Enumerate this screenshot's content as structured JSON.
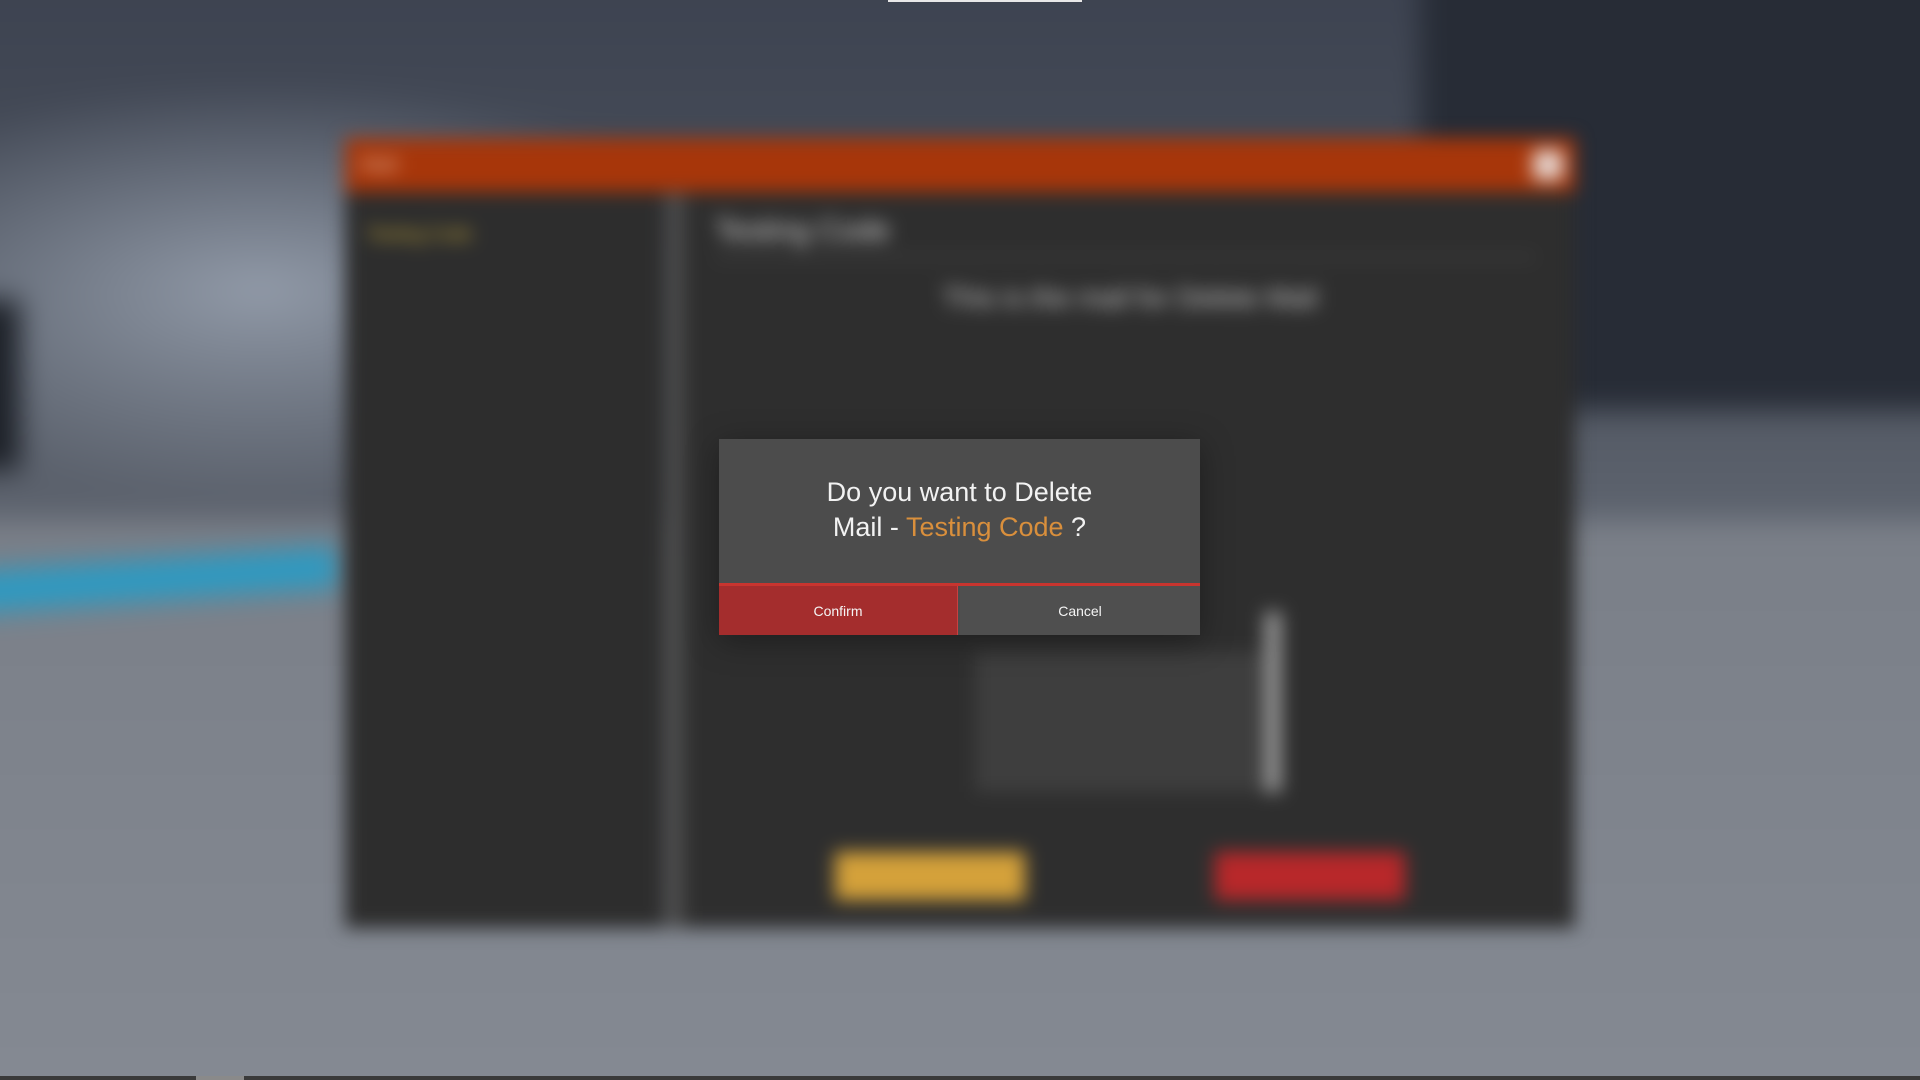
{
  "background_window": {
    "title": "Mail",
    "sidebar_item": "Testing Code",
    "heading": "Testing Code",
    "body_text": "This is the mail for Delete Mail"
  },
  "modal": {
    "line1": "Do you want to Delete",
    "line2_prefix": "Mail - ",
    "item_name": "Testing Code",
    "line2_suffix": " ?",
    "confirm_label": "Confirm",
    "cancel_label": "Cancel"
  },
  "colors": {
    "highlight": "#d98f3c",
    "confirm_button": "#a42d2d",
    "titlebar": "#a7360a"
  }
}
